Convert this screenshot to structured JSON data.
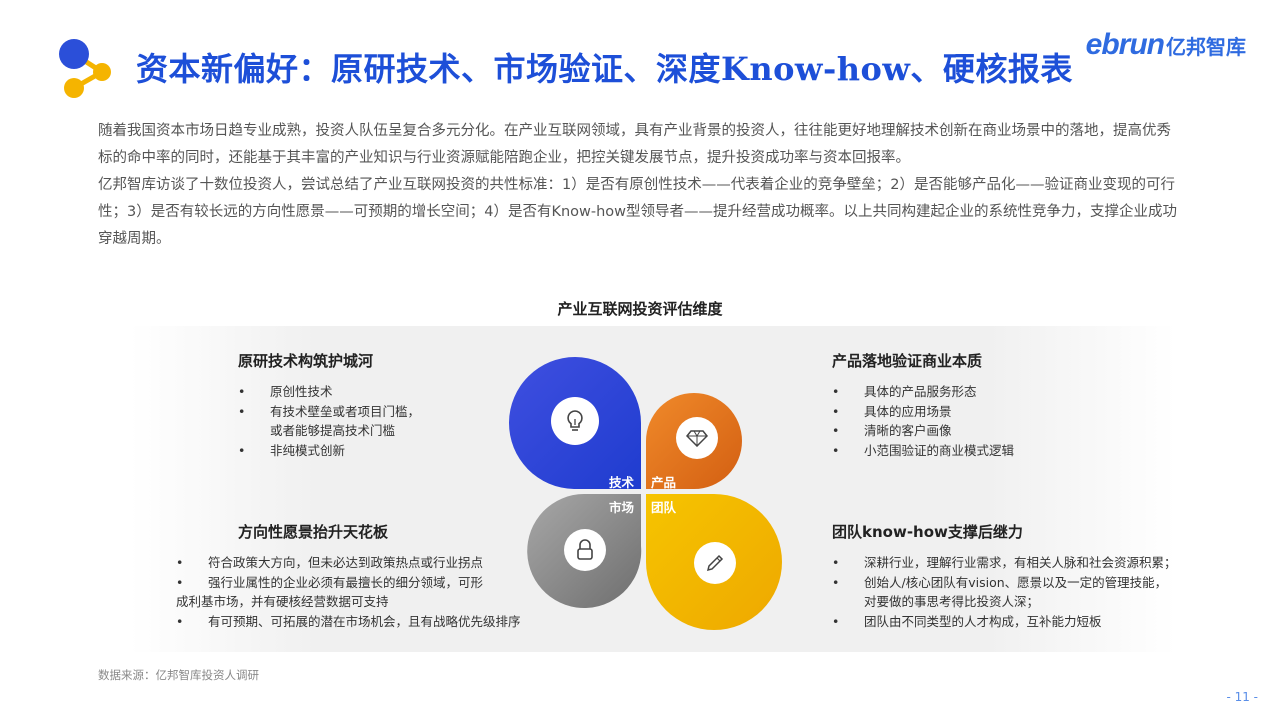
{
  "header": {
    "title": "资本新偏好：原研技术、市场验证、深度Know-how、硬核报表",
    "brand_en": "ebrun",
    "brand_cn": "亿邦智库"
  },
  "intro": {
    "p1": "随着我国资本市场日趋专业成熟，投资人队伍呈复合多元分化。在产业互联网领域，具有产业背景的投资人，往往能更好地理解技术创新在商业场景中的落地，提高优秀标的命中率的同时，还能基于其丰富的产业知识与行业资源赋能陪跑企业，把控关键发展节点，提升投资成功率与资本回报率。",
    "p2": "亿邦智库访谈了十数位投资人，尝试总结了产业互联网投资的共性标准：1）是否有原创性技术——代表着企业的竞争壁垒；2）是否能够产品化——验证商业变现的可行性；3）是否有较长远的方向性愿景——可预期的增长空间；4）是否有Know-how型领导者——提升经营成功概率。以上共同构建起企业的系统性竞争力，支撑企业成功穿越周期。"
  },
  "chart": {
    "title": "产业互联网投资评估维度",
    "petals": {
      "tech": "技术",
      "product": "产品",
      "market": "市场",
      "team": "团队"
    },
    "quadrants": {
      "top_left": {
        "title": "原研技术构筑护城河",
        "items": [
          "原创性技术",
          "有技术壁垒或者项目门槛，",
          "或者能够提高技术门槛",
          "非纯模式创新"
        ]
      },
      "top_right": {
        "title": "产品落地验证商业本质",
        "items": [
          "具体的产品服务形态",
          "具体的应用场景",
          "清晰的客户画像",
          "小范围验证的商业模式逻辑"
        ]
      },
      "bottom_left": {
        "title": "方向性愿景抬升天花板",
        "items": [
          "符合政策大方向，但未必达到政策热点或行业拐点",
          "强行业属性的企业必须有最擅长的细分领域，可形",
          "成利基市场，并有硬核经营数据可支持",
          "有可预期、可拓展的潜在市场机会，且有战略优先级排序"
        ]
      },
      "bottom_right": {
        "title": "团队know-how支撑后继力",
        "items": [
          "深耕行业，理解行业需求，有相关人脉和社会资源积累；",
          "创始人/核心团队有vision、愿景以及一定的管理技能，",
          "对要做的事思考得比投资人深；",
          "团队由不同类型的人才构成，互补能力短板"
        ]
      }
    }
  },
  "footer": {
    "source": "数据来源：亿邦智库投资人调研",
    "page": "- 11 -"
  },
  "colors": {
    "title_blue": "#1d4fd8",
    "petal_tech": "#2946d6",
    "petal_product": "#e8741e",
    "petal_market": "#8a8a8a",
    "petal_team": "#f2b200"
  }
}
